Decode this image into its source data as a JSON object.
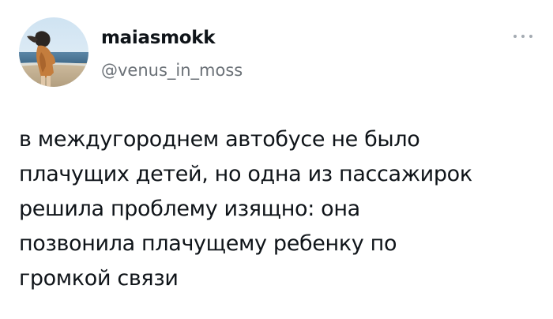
{
  "author": {
    "display_name": "maiasmokk",
    "handle": "@venus_in_moss",
    "avatar_icon": "profile-photo-person-on-beach"
  },
  "tweet": {
    "lines": [
      "в междугороднем автобусе не было",
      "плачущих детей, но одна из пассажирок",
      "решила проблему изящно: она",
      "позвонила плачущему ребенку по",
      "громкой связи"
    ]
  },
  "menu": {
    "icon": "more-options-icon"
  },
  "colors": {
    "text": "#0f1419",
    "secondary_text": "#6b7177",
    "background": "#ffffff"
  }
}
